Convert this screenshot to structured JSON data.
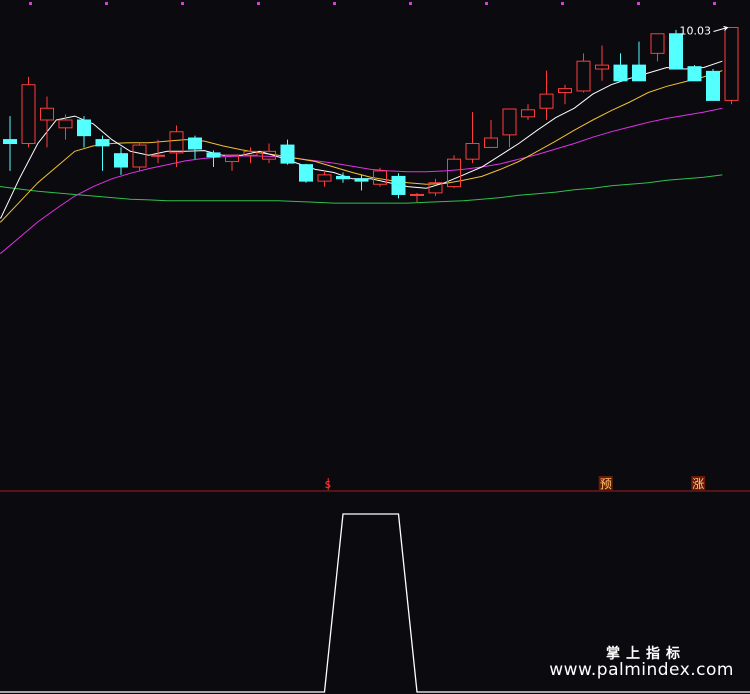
{
  "watermark": {
    "brand_cn": "掌上指标",
    "url": "www.palmindex.com"
  },
  "chart_data": [
    {
      "type": "candlestick",
      "title": "",
      "price_label": "10.03",
      "ylim": [
        7.0,
        10.1
      ],
      "colors": {
        "up": "#ff3c3c",
        "down": "#54ffff",
        "ma5": "#ffffff",
        "ma10": "#f1c232",
        "ma20": "#e032e6",
        "ma60": "#2fc14c"
      },
      "candles": [
        {
          "o": 8.6,
          "h": 8.9,
          "l": 8.2,
          "c": 8.55
        },
        {
          "o": 8.55,
          "h": 9.4,
          "l": 8.5,
          "c": 9.3
        },
        {
          "o": 8.85,
          "h": 9.15,
          "l": 8.5,
          "c": 9.0
        },
        {
          "o": 8.75,
          "h": 8.92,
          "l": 8.6,
          "c": 8.85
        },
        {
          "o": 8.85,
          "h": 8.9,
          "l": 8.5,
          "c": 8.65
        },
        {
          "o": 8.6,
          "h": 8.65,
          "l": 8.2,
          "c": 8.52
        },
        {
          "o": 8.42,
          "h": 8.5,
          "l": 8.15,
          "c": 8.25
        },
        {
          "o": 8.25,
          "h": 8.56,
          "l": 8.2,
          "c": 8.53
        },
        {
          "o": 8.4,
          "h": 8.6,
          "l": 8.3,
          "c": 8.4
        },
        {
          "o": 8.43,
          "h": 8.78,
          "l": 8.25,
          "c": 8.7
        },
        {
          "o": 8.62,
          "h": 8.65,
          "l": 8.35,
          "c": 8.48
        },
        {
          "o": 8.43,
          "h": 8.46,
          "l": 8.25,
          "c": 8.38
        },
        {
          "o": 8.32,
          "h": 8.4,
          "l": 8.2,
          "c": 8.4
        },
        {
          "o": 8.4,
          "h": 8.5,
          "l": 8.3,
          "c": 8.45
        },
        {
          "o": 8.35,
          "h": 8.55,
          "l": 8.3,
          "c": 8.45
        },
        {
          "o": 8.53,
          "h": 8.6,
          "l": 8.28,
          "c": 8.3
        },
        {
          "o": 8.28,
          "h": 8.29,
          "l": 8.05,
          "c": 8.07
        },
        {
          "o": 8.07,
          "h": 8.2,
          "l": 8.0,
          "c": 8.15
        },
        {
          "o": 8.13,
          "h": 8.18,
          "l": 8.05,
          "c": 8.1
        },
        {
          "o": 8.1,
          "h": 8.15,
          "l": 7.95,
          "c": 8.07
        },
        {
          "o": 8.03,
          "h": 8.24,
          "l": 8.0,
          "c": 8.2
        },
        {
          "o": 8.13,
          "h": 8.17,
          "l": 7.85,
          "c": 7.9
        },
        {
          "o": 7.9,
          "h": 7.92,
          "l": 7.8,
          "c": 7.9
        },
        {
          "o": 7.92,
          "h": 8.1,
          "l": 7.88,
          "c": 8.05
        },
        {
          "o": 8.0,
          "h": 8.4,
          "l": 7.98,
          "c": 8.35
        },
        {
          "o": 8.35,
          "h": 8.95,
          "l": 8.3,
          "c": 8.55
        },
        {
          "o": 8.5,
          "h": 8.85,
          "l": 8.5,
          "c": 8.62
        },
        {
          "o": 8.66,
          "h": 8.99,
          "l": 8.5,
          "c": 8.99
        },
        {
          "o": 8.89,
          "h": 9.05,
          "l": 8.85,
          "c": 8.98
        },
        {
          "o": 9.0,
          "h": 9.48,
          "l": 8.85,
          "c": 9.18
        },
        {
          "o": 9.2,
          "h": 9.3,
          "l": 9.05,
          "c": 9.25
        },
        {
          "o": 9.22,
          "h": 9.7,
          "l": 9.2,
          "c": 9.6
        },
        {
          "o": 9.5,
          "h": 9.8,
          "l": 9.35,
          "c": 9.55
        },
        {
          "o": 9.55,
          "h": 9.7,
          "l": 9.45,
          "c": 9.35
        },
        {
          "o": 9.55,
          "h": 9.85,
          "l": 9.45,
          "c": 9.35
        },
        {
          "o": 9.7,
          "h": 9.95,
          "l": 9.6,
          "c": 9.95
        },
        {
          "o": 9.95,
          "h": 10.0,
          "l": 9.5,
          "c": 9.5
        },
        {
          "o": 9.53,
          "h": 9.55,
          "l": 9.35,
          "c": 9.35
        },
        {
          "o": 9.47,
          "h": 9.5,
          "l": 9.15,
          "c": 9.1
        },
        {
          "o": 9.1,
          "h": 10.03,
          "l": 9.05,
          "c": 10.03
        }
      ],
      "ma5": [
        7.6,
        8.1,
        8.55,
        8.85,
        8.9,
        8.8,
        8.6,
        8.45,
        8.4,
        8.45,
        8.45,
        8.46,
        8.4,
        8.4,
        8.45,
        8.38,
        8.3,
        8.22,
        8.18,
        8.1,
        8.1,
        8.05,
        8.0,
        7.98,
        8.05,
        8.15,
        8.25,
        8.4,
        8.55,
        8.72,
        8.88,
        9.0,
        9.18,
        9.3,
        9.38,
        9.45,
        9.52,
        9.5,
        9.52,
        9.6
      ],
      "ma10": [
        7.55,
        7.8,
        8.05,
        8.25,
        8.45,
        8.52,
        8.55,
        8.56,
        8.56,
        8.58,
        8.6,
        8.58,
        8.52,
        8.47,
        8.43,
        8.4,
        8.36,
        8.32,
        8.25,
        8.18,
        8.12,
        8.08,
        8.05,
        8.03,
        8.04,
        8.08,
        8.13,
        8.22,
        8.32,
        8.45,
        8.58,
        8.72,
        8.85,
        8.97,
        9.08,
        9.2,
        9.28,
        9.34,
        9.4,
        9.48
      ],
      "ma20": [
        7.15,
        7.35,
        7.55,
        7.72,
        7.88,
        8.0,
        8.1,
        8.17,
        8.23,
        8.28,
        8.33,
        8.36,
        8.38,
        8.39,
        8.39,
        8.38,
        8.36,
        8.33,
        8.3,
        8.26,
        8.22,
        8.2,
        8.19,
        8.19,
        8.2,
        8.22,
        8.25,
        8.29,
        8.35,
        8.41,
        8.48,
        8.55,
        8.63,
        8.7,
        8.76,
        8.82,
        8.87,
        8.91,
        8.95,
        9.0
      ],
      "ma60": [
        8.0,
        7.97,
        7.94,
        7.92,
        7.9,
        7.88,
        7.86,
        7.84,
        7.83,
        7.82,
        7.82,
        7.82,
        7.82,
        7.82,
        7.82,
        7.82,
        7.81,
        7.8,
        7.79,
        7.79,
        7.79,
        7.79,
        7.79,
        7.8,
        7.81,
        7.82,
        7.84,
        7.86,
        7.89,
        7.91,
        7.93,
        7.96,
        7.98,
        8.01,
        8.03,
        8.05,
        8.08,
        8.1,
        8.12,
        8.15
      ]
    },
    {
      "type": "line",
      "title": "",
      "ylim": [
        0,
        1
      ],
      "values": [
        0,
        0,
        0,
        0,
        0,
        0,
        0,
        0,
        0,
        0,
        0,
        0,
        0,
        0,
        0,
        0,
        0,
        0,
        1,
        1,
        1,
        1,
        0,
        0,
        0,
        0,
        0,
        0,
        0,
        0,
        0,
        0,
        0,
        0,
        0,
        0,
        0,
        0,
        0,
        0
      ],
      "signals": [
        {
          "index": 18,
          "label": "s",
          "marker": "arrow-icon"
        },
        {
          "index": 33,
          "label": "预"
        },
        {
          "index": 38,
          "label": "涨"
        }
      ]
    }
  ]
}
